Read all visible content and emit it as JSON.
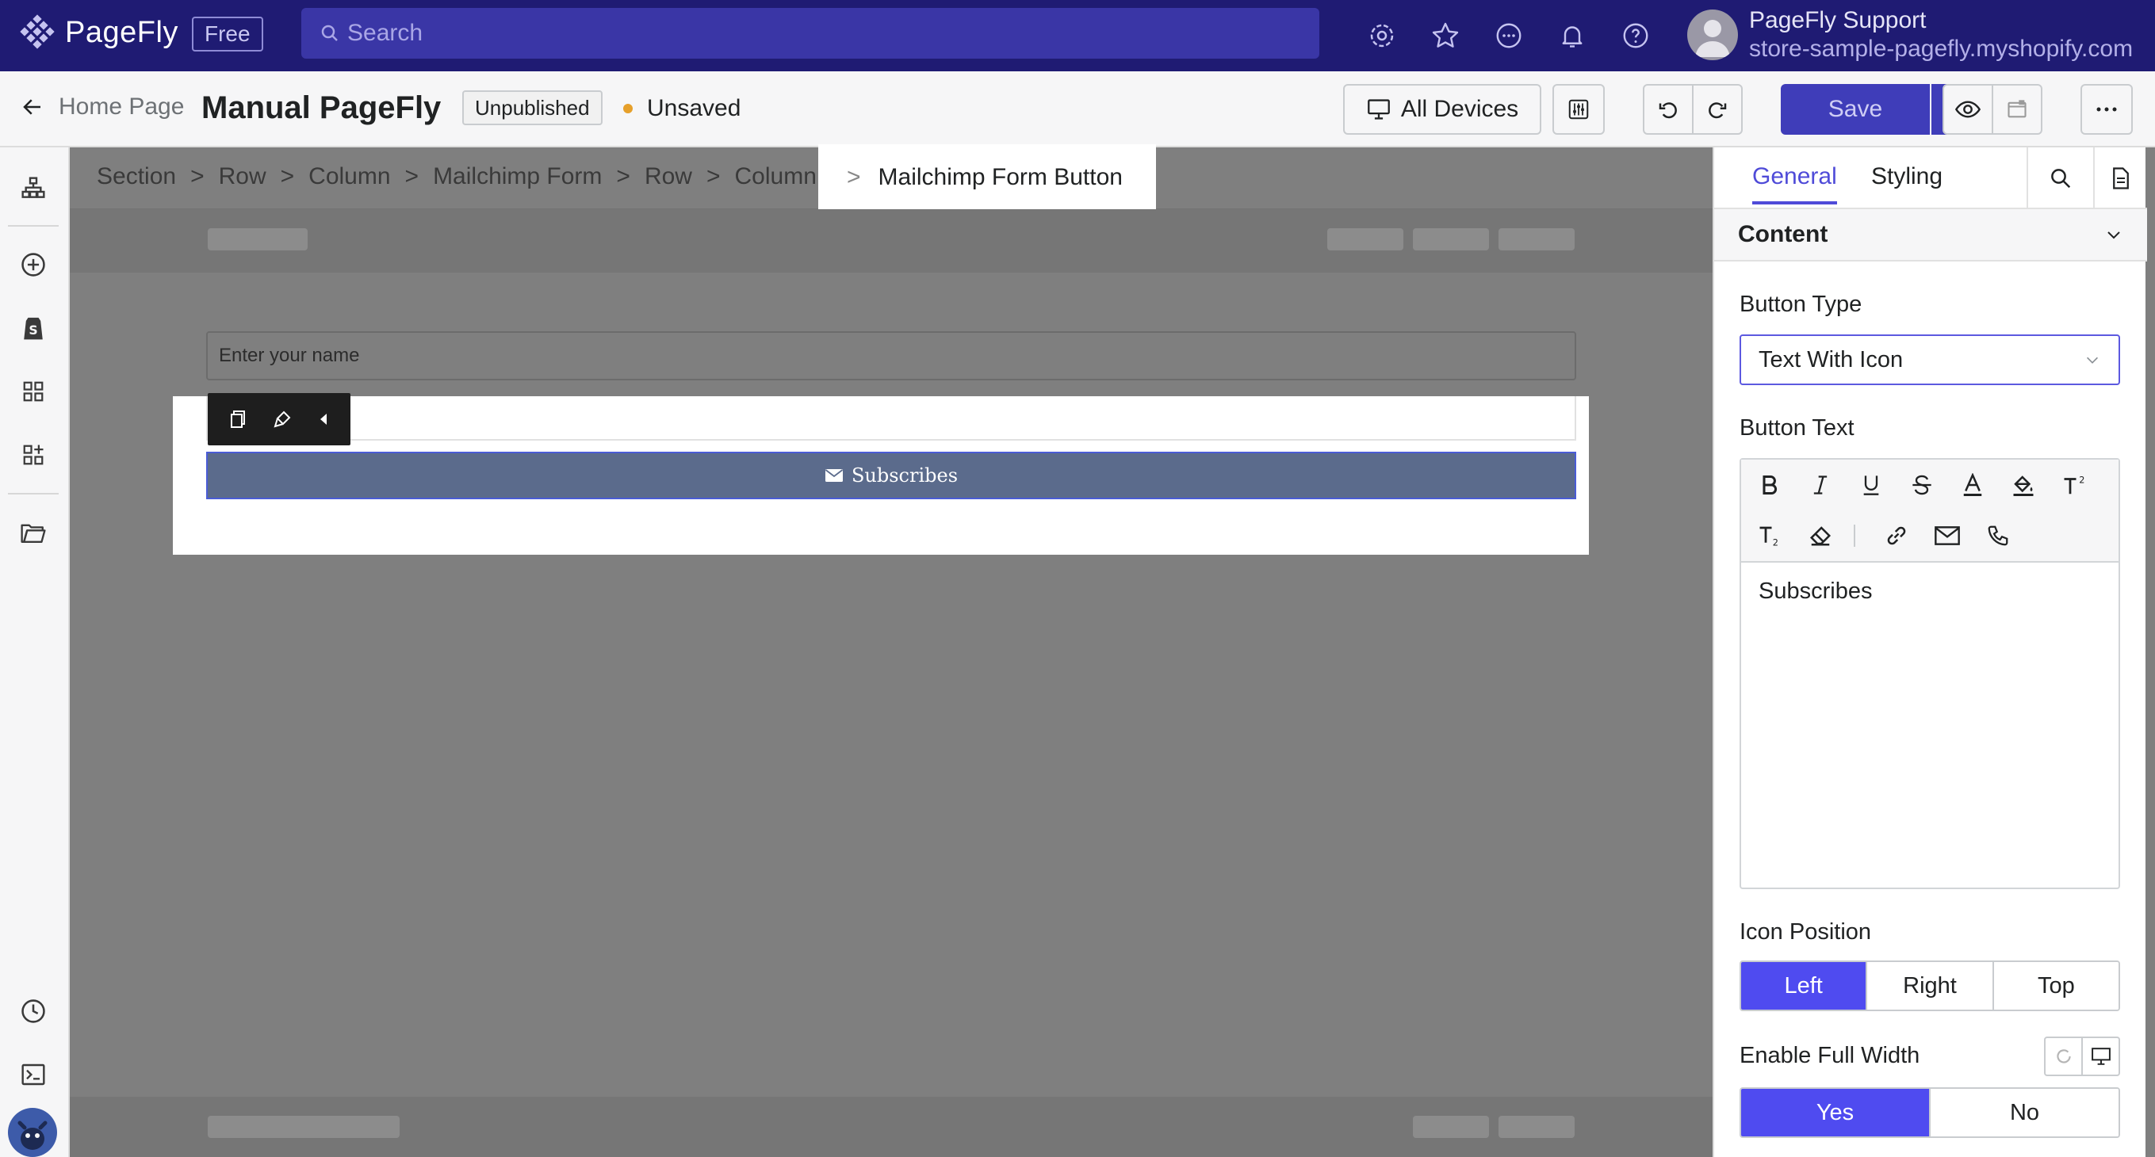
{
  "app": {
    "name": "PageFly",
    "plan": "Free"
  },
  "search": {
    "placeholder": "Search"
  },
  "user": {
    "name": "PageFly Support",
    "store": "store-sample-pagefly.myshopify.com"
  },
  "page": {
    "back_label": "Home Page",
    "title": "Manual PageFly",
    "status": "Unpublished",
    "save_state": "Unsaved"
  },
  "toolbar": {
    "devices_label": "All Devices",
    "save_label": "Save"
  },
  "breadcrumb": {
    "items": [
      "Section",
      "Row",
      "Column",
      "Mailchimp Form",
      "Row",
      "Column"
    ],
    "active": "Mailchimp Form Button"
  },
  "canvas": {
    "name_placeholder": "Enter your name",
    "button_label": "Subscribes"
  },
  "panel": {
    "tabs": {
      "general": "General",
      "styling": "Styling"
    },
    "section_title": "Content",
    "button_type": {
      "label": "Button Type",
      "value": "Text With Icon"
    },
    "button_text": {
      "label": "Button Text",
      "value": "Subscribes"
    },
    "icon_position": {
      "label": "Icon Position",
      "options": [
        "Left",
        "Right",
        "Top"
      ],
      "selected": "Left"
    },
    "full_width": {
      "label": "Enable Full Width",
      "options": [
        "Yes",
        "No"
      ],
      "selected": "Yes"
    }
  },
  "colors": {
    "topbar": "#1f1b73",
    "accent": "#4f4bf0",
    "save_button": "#3f3db9",
    "unsaved_dot": "#e6a02b",
    "subscribe_button": "#5b6b8c"
  },
  "icons": {
    "top": [
      "settings-icon",
      "star-icon",
      "chat-icon",
      "bell-icon",
      "help-icon"
    ],
    "rail": [
      "layers-icon",
      "add-icon",
      "shopify-icon",
      "grid-icon",
      "add-grid-icon",
      "folder-icon",
      "history-icon",
      "terminal-icon",
      "mascot-icon"
    ]
  }
}
